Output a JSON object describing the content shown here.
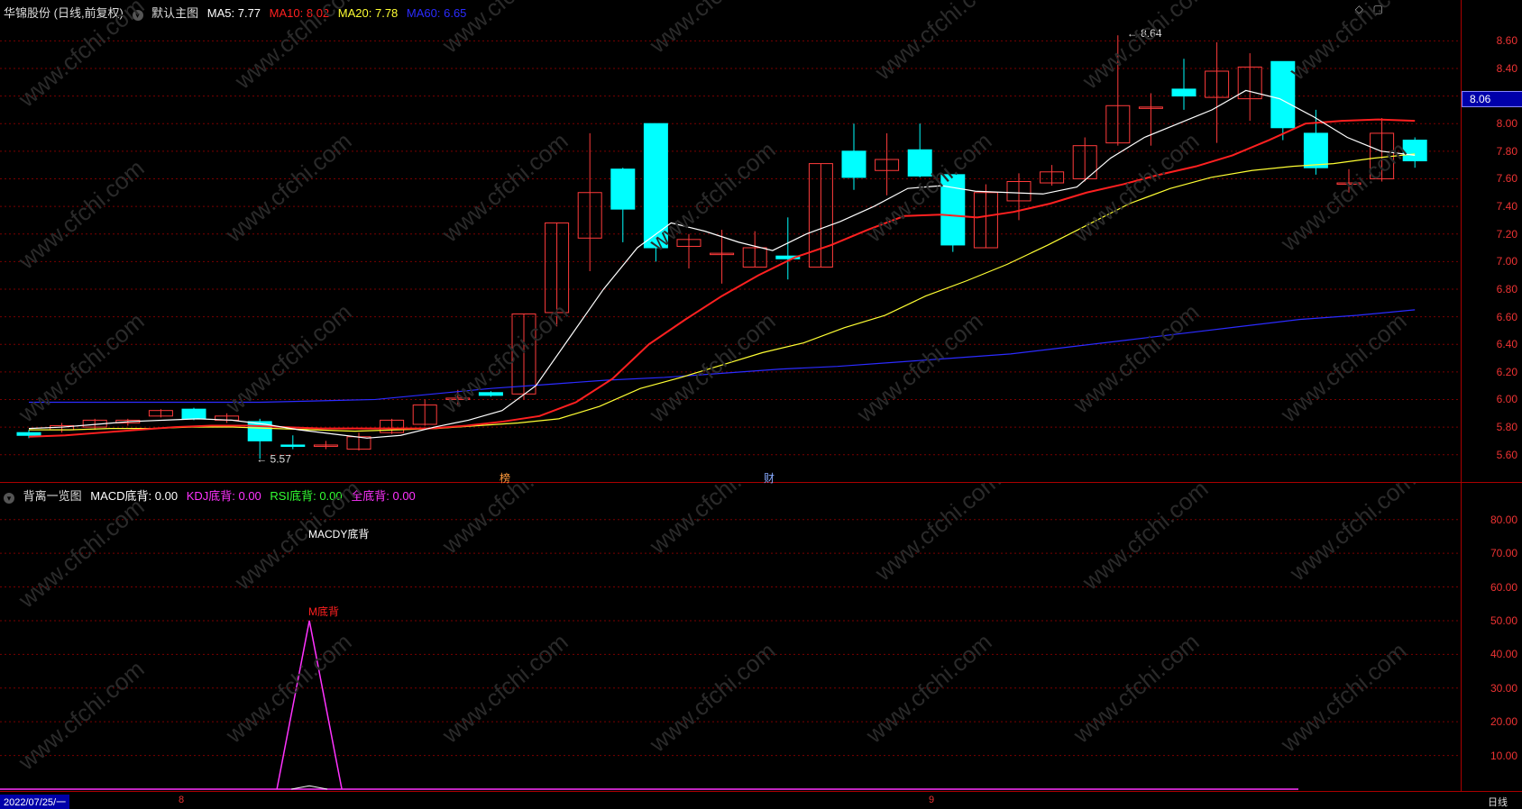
{
  "main": {
    "stock": "华锦股份 (日线,前复权)",
    "panel_name": "默认主图",
    "ma": [
      {
        "label": "MA5: 7.77",
        "color": "#ffffff"
      },
      {
        "label": "MA10: 8.02",
        "color": "#ff2020"
      },
      {
        "label": "MA20: 7.78",
        "color": "#ffff33"
      },
      {
        "label": "MA60: 6.65",
        "color": "#2b2bff"
      }
    ],
    "high_label": "8.64",
    "low_label": "5.57",
    "current_price": "8.06",
    "badge_bang": "榜",
    "badge_cai": "财",
    "y_ticks": [
      "8.60",
      "8.40",
      "8.20",
      "8.00",
      "7.80",
      "7.60",
      "7.40",
      "7.20",
      "7.00",
      "6.80",
      "6.60",
      "6.40",
      "6.20",
      "6.00",
      "5.80",
      "5.60"
    ]
  },
  "sub": {
    "title": "背离一览图",
    "items": [
      {
        "label": "MACD底背: 0.00",
        "color": "#ffffff"
      },
      {
        "label": "KDJ底背: 0.00",
        "color": "#ff33ff"
      },
      {
        "label": "RSI底背: 0.00",
        "color": "#33ff33"
      },
      {
        "label": "全底背: 0.00",
        "color": "#ff33ff"
      }
    ],
    "annotation_macdy": "MACDY底背",
    "annotation_m": "M底背",
    "y_ticks": [
      "80.00",
      "70.00",
      "60.00",
      "50.00",
      "40.00",
      "30.00",
      "20.00",
      "10.00"
    ]
  },
  "footer": {
    "date": "2022/07/25/一",
    "month_8": "8",
    "month_9": "9",
    "period": "日线"
  },
  "watermark": "www.cfchi.com",
  "colors": {
    "up": "#ff3b3b",
    "down": "#00ffff",
    "ma5": "#ffffff",
    "ma10": "#ff2020",
    "ma20": "#ffff33",
    "ma60": "#2b2bff"
  },
  "chart_data": {
    "type": "candlestick",
    "ylim": [
      5.5,
      8.7
    ],
    "candles": [
      {
        "o": 5.76,
        "c": 5.74,
        "h": 5.78,
        "l": 5.72
      },
      {
        "o": 5.78,
        "c": 5.81,
        "h": 5.83,
        "l": 5.76
      },
      {
        "o": 5.8,
        "c": 5.85,
        "h": 5.86,
        "l": 5.78
      },
      {
        "o": 5.83,
        "c": 5.85,
        "h": 5.86,
        "l": 5.81
      },
      {
        "o": 5.88,
        "c": 5.92,
        "h": 5.93,
        "l": 5.87
      },
      {
        "o": 5.93,
        "c": 5.86,
        "h": 5.94,
        "l": 5.85
      },
      {
        "o": 5.85,
        "c": 5.88,
        "h": 5.9,
        "l": 5.83
      },
      {
        "o": 5.84,
        "c": 5.7,
        "h": 5.86,
        "l": 5.57
      },
      {
        "o": 5.67,
        "c": 5.66,
        "h": 5.74,
        "l": 5.64
      },
      {
        "o": 5.67,
        "c": 5.67,
        "h": 5.7,
        "l": 5.64
      },
      {
        "o": 5.64,
        "c": 5.73,
        "h": 5.76,
        "l": 5.63
      },
      {
        "o": 5.76,
        "c": 5.85,
        "h": 5.86,
        "l": 5.75
      },
      {
        "o": 5.82,
        "c": 5.96,
        "h": 6.0,
        "l": 5.81
      },
      {
        "o": 6.01,
        "c": 6.01,
        "h": 6.07,
        "l": 5.95
      },
      {
        "o": 6.05,
        "c": 6.03,
        "h": 6.06,
        "l": 6.02
      },
      {
        "o": 6.04,
        "c": 6.62,
        "h": 6.62,
        "l": 6.0
      },
      {
        "o": 6.63,
        "c": 7.28,
        "h": 7.28,
        "l": 6.53
      },
      {
        "o": 7.17,
        "c": 7.5,
        "h": 7.93,
        "l": 6.93
      },
      {
        "o": 7.67,
        "c": 7.38,
        "h": 7.68,
        "l": 7.14
      },
      {
        "o": 8.0,
        "c": 7.1,
        "h": 8.0,
        "l": 7.0
      },
      {
        "o": 7.11,
        "c": 7.16,
        "h": 7.2,
        "l": 6.95
      },
      {
        "o": 7.06,
        "c": 7.06,
        "h": 7.23,
        "l": 6.84
      },
      {
        "o": 6.96,
        "c": 7.1,
        "h": 7.22,
        "l": 6.96
      },
      {
        "o": 7.04,
        "c": 7.02,
        "h": 7.32,
        "l": 6.87
      },
      {
        "o": 6.96,
        "c": 7.71,
        "h": 7.71,
        "l": 6.96
      },
      {
        "o": 7.8,
        "c": 7.61,
        "h": 8.0,
        "l": 7.52
      },
      {
        "o": 7.66,
        "c": 7.74,
        "h": 7.93,
        "l": 7.48
      },
      {
        "o": 7.81,
        "c": 7.62,
        "h": 8.0,
        "l": 7.61
      },
      {
        "o": 7.63,
        "c": 7.12,
        "h": 7.63,
        "l": 7.07
      },
      {
        "o": 7.1,
        "c": 7.5,
        "h": 7.56,
        "l": 7.1
      },
      {
        "o": 7.44,
        "c": 7.58,
        "h": 7.64,
        "l": 7.3
      },
      {
        "o": 7.57,
        "c": 7.65,
        "h": 7.7,
        "l": 7.55
      },
      {
        "o": 7.6,
        "c": 7.84,
        "h": 7.9,
        "l": 7.58
      },
      {
        "o": 7.86,
        "c": 8.13,
        "h": 8.64,
        "l": 7.84
      },
      {
        "o": 8.11,
        "c": 8.12,
        "h": 8.22,
        "l": 7.84
      },
      {
        "o": 8.25,
        "c": 8.2,
        "h": 8.47,
        "l": 8.1
      },
      {
        "o": 8.19,
        "c": 8.38,
        "h": 8.59,
        "l": 7.86
      },
      {
        "o": 8.18,
        "c": 8.41,
        "h": 8.51,
        "l": 8.02
      },
      {
        "o": 8.45,
        "c": 7.97,
        "h": 8.45,
        "l": 7.88
      },
      {
        "o": 7.93,
        "c": 7.68,
        "h": 8.1,
        "l": 7.63
      },
      {
        "o": 7.56,
        "c": 7.57,
        "h": 7.67,
        "l": 7.5
      },
      {
        "o": 7.6,
        "c": 7.93,
        "h": 8.04,
        "l": 7.58
      },
      {
        "o": 7.88,
        "c": 7.73,
        "h": 7.9,
        "l": 7.68
      }
    ],
    "ma5": [
      5.79,
      5.8,
      5.82,
      5.84,
      5.85,
      5.86,
      5.85,
      5.82,
      5.78,
      5.75,
      5.72,
      5.74,
      5.8,
      5.85,
      5.92,
      6.1,
      6.45,
      6.8,
      7.1,
      7.28,
      7.22,
      7.14,
      7.08,
      7.2,
      7.29,
      7.4,
      7.53,
      7.55,
      7.51,
      7.5,
      7.49,
      7.54,
      7.75,
      7.9,
      8.0,
      8.1,
      8.24,
      8.18,
      8.05,
      7.9,
      7.8,
      7.77
    ],
    "ma10": [
      5.73,
      5.74,
      5.76,
      5.78,
      5.8,
      5.81,
      5.81,
      5.8,
      5.79,
      5.79,
      5.79,
      5.79,
      5.81,
      5.84,
      5.88,
      5.98,
      6.15,
      6.4,
      6.58,
      6.75,
      6.9,
      7.03,
      7.12,
      7.23,
      7.33,
      7.34,
      7.32,
      7.36,
      7.42,
      7.5,
      7.56,
      7.63,
      7.69,
      7.77,
      7.88,
      8.0,
      8.02,
      8.03,
      8.02
    ],
    "ma20": [
      5.78,
      5.78,
      5.79,
      5.79,
      5.8,
      5.8,
      5.79,
      5.78,
      5.77,
      5.78,
      5.79,
      5.81,
      5.83,
      5.86,
      5.95,
      6.08,
      6.16,
      6.25,
      6.34,
      6.41,
      6.52,
      6.61,
      6.75,
      6.86,
      6.98,
      7.12,
      7.27,
      7.42,
      7.53,
      7.61,
      7.66,
      7.69,
      7.71,
      7.75,
      7.78
    ],
    "ma60": [
      5.98,
      5.98,
      5.98,
      5.98,
      5.98,
      5.99,
      6.0,
      6.04,
      6.08,
      6.11,
      6.14,
      6.16,
      6.19,
      6.22,
      6.24,
      6.27,
      6.3,
      6.33,
      6.38,
      6.43,
      6.48,
      6.53,
      6.58,
      6.61,
      6.65
    ],
    "sub_peak_value": 50
  }
}
